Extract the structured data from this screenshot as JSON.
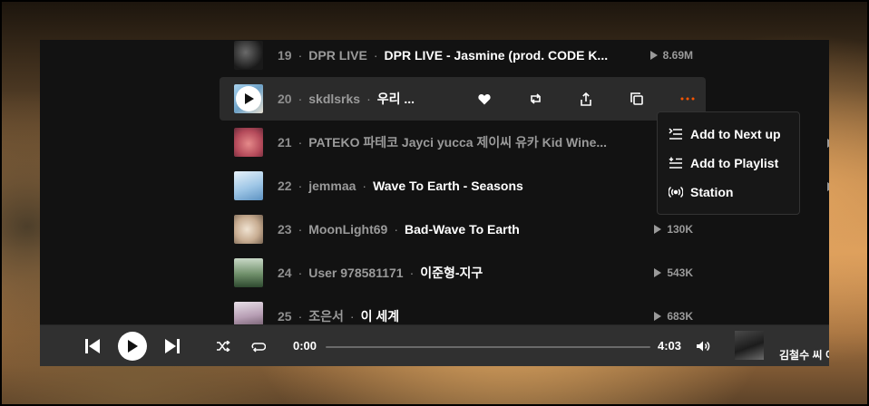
{
  "tracks": [
    {
      "index": "19",
      "artist": "DPR LIVE",
      "title": "DPR LIVE - Jasmine (prod. CODE K...",
      "plays": "8.69M"
    },
    {
      "index": "20",
      "artist": "skdlsrks",
      "title": "우리 ...",
      "plays": ""
    },
    {
      "index": "21",
      "artist": "PATEKO 파테코 Jayci yucca 제이씨 유카 Kid Wine...",
      "title": "",
      "plays": ""
    },
    {
      "index": "22",
      "artist": "jemmaa",
      "title": "Wave To Earth - Seasons",
      "plays": ""
    },
    {
      "index": "23",
      "artist": "MoonLight69",
      "title": "Bad-Wave To Earth",
      "plays": "130K"
    },
    {
      "index": "24",
      "artist": "User 978581171",
      "title": "이준형-지구",
      "plays": "543K"
    },
    {
      "index": "25",
      "artist": "조은서",
      "title": "이 세계",
      "plays": "683K"
    }
  ],
  "separator": "·",
  "row_actions": [
    "heart-icon",
    "repost-icon",
    "share-icon",
    "copy-link-icon",
    "more-icon"
  ],
  "context_menu": {
    "items": [
      {
        "label": "Add to Next up",
        "icon": "next-up-icon"
      },
      {
        "label": "Add to Playlist",
        "icon": "add-playlist-icon"
      },
      {
        "label": "Station",
        "icon": "station-icon"
      }
    ]
  },
  "player": {
    "current_time": "0:00",
    "duration": "4:03",
    "progress": 0,
    "now_playing_title": "김철수 씨 이"
  },
  "colors": {
    "accent": "#ff5500",
    "background": "#121212",
    "active_row": "#2b2b2b",
    "player_bar": "#303030"
  }
}
